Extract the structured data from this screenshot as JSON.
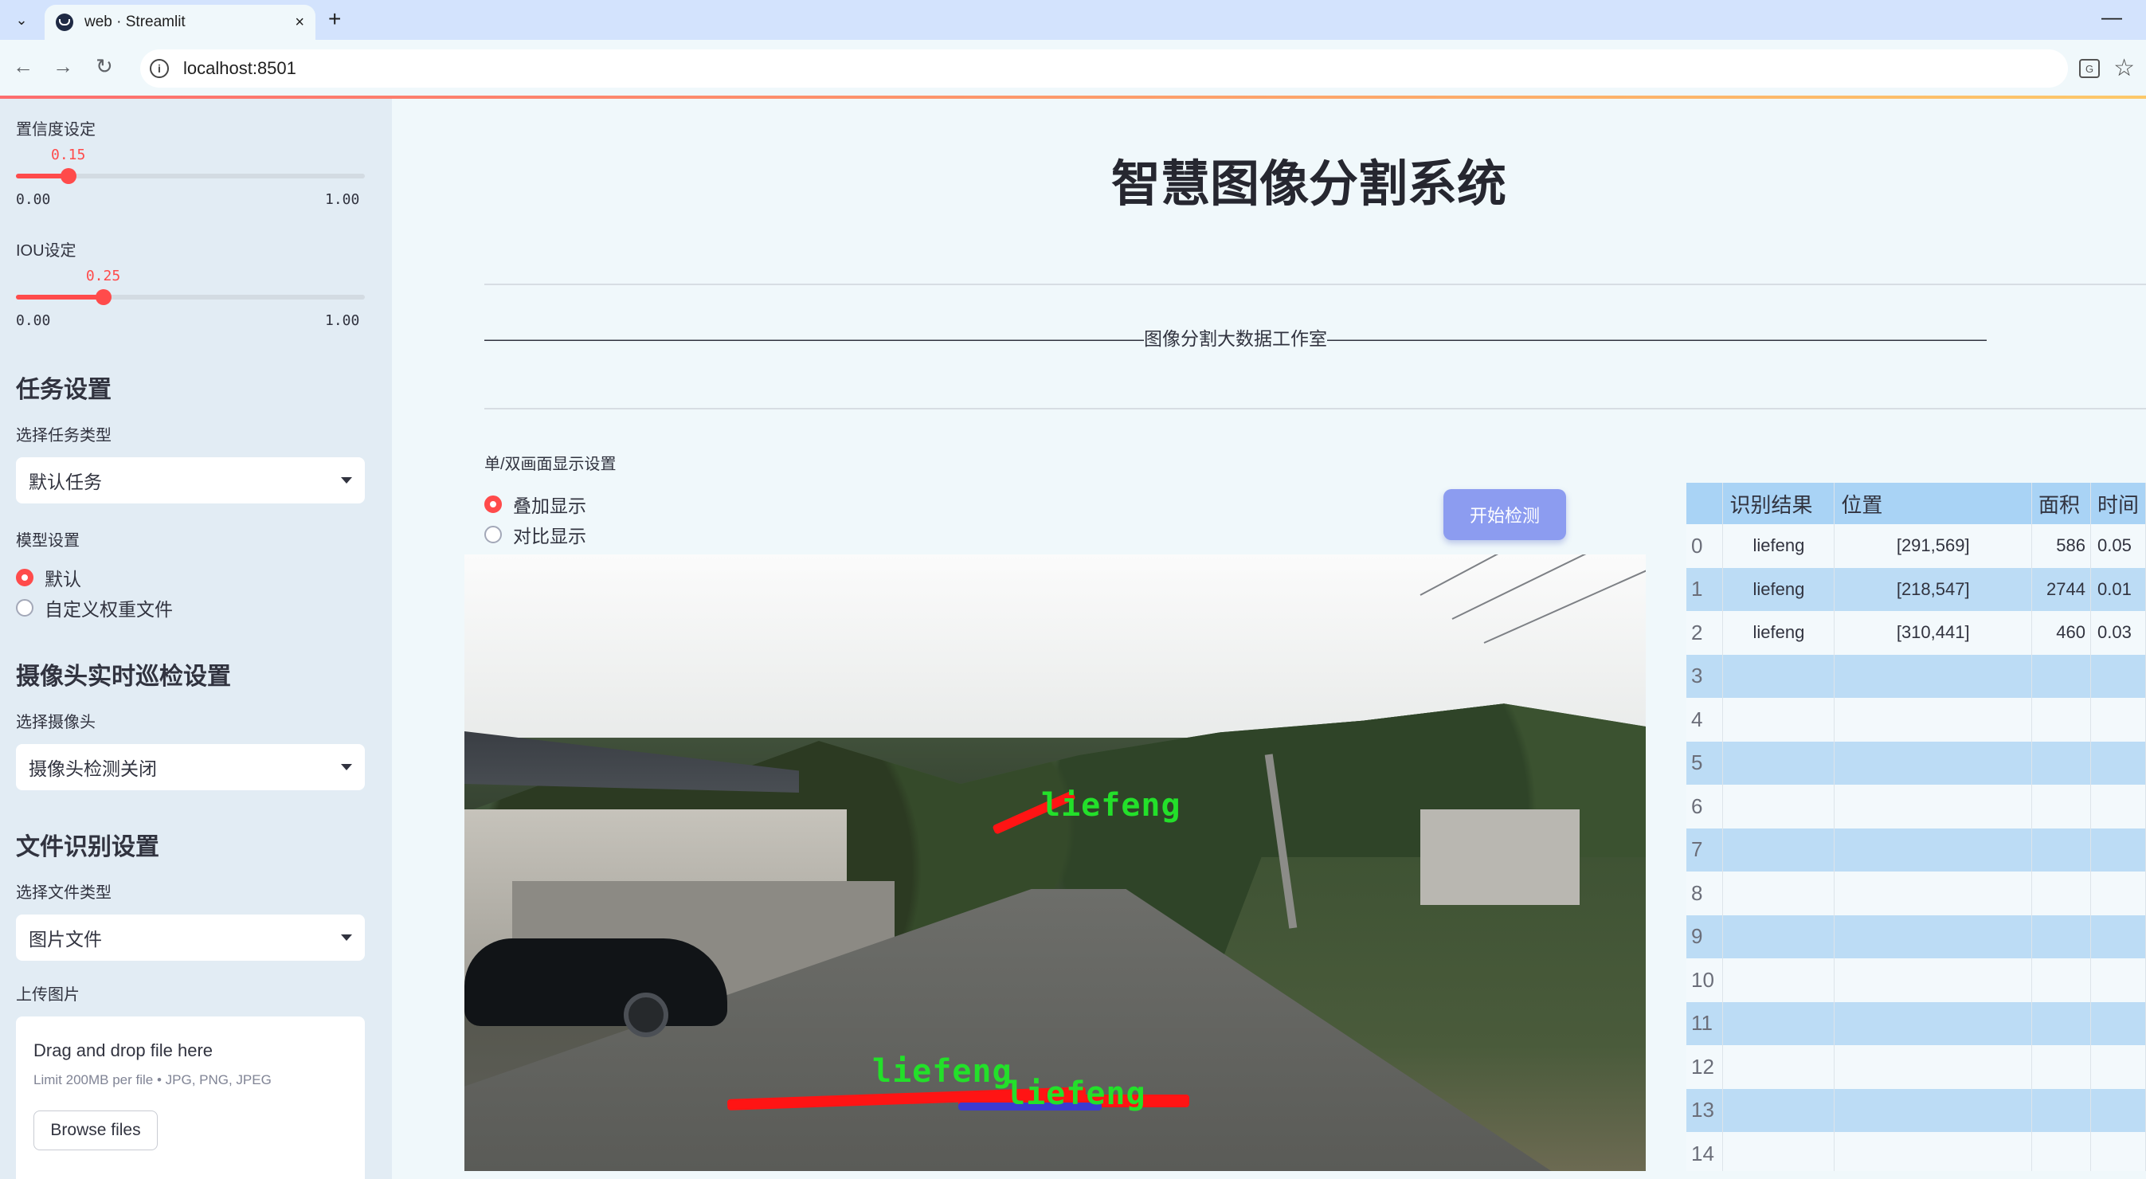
{
  "browser": {
    "tab_title": "web · Streamlit",
    "url": "localhost:8501",
    "new_tab_symbol": "+",
    "close_symbol": "×"
  },
  "sidebar": {
    "confidence": {
      "label": "置信度设定",
      "value": 0.15,
      "value_text": "0.15",
      "min": "0.00",
      "max": "1.00"
    },
    "iou": {
      "label": "IOU设定",
      "value": 0.25,
      "value_text": "0.25",
      "min": "0.00",
      "max": "1.00"
    },
    "task": {
      "heading": "任务设置",
      "label": "选择任务类型",
      "selected": "默认任务"
    },
    "model": {
      "label": "模型设置",
      "options": [
        "默认",
        "自定义权重文件"
      ],
      "selected_index": 0
    },
    "camera": {
      "heading": "摄像头实时巡检设置",
      "label": "选择摄像头",
      "selected": "摄像头检测关闭"
    },
    "file": {
      "heading": "文件识别设置",
      "label": "选择文件类型",
      "selected": "图片文件"
    },
    "upload": {
      "label": "上传图片",
      "title": "Drag and drop file here",
      "subtitle": "Limit 200MB per file • JPG, PNG, JPEG",
      "button": "Browse files"
    }
  },
  "main": {
    "title": "智慧图像分割系统",
    "banner": "————————————————————————————————————图像分割大数据工作室————————————————————————————————————",
    "view_label": "单/双画面显示设置",
    "view_options": [
      "叠加显示",
      "对比显示"
    ],
    "view_selected_index": 0,
    "start_button": "开始检测",
    "detections": [
      {
        "label": "liefeng"
      },
      {
        "label": "liefeng"
      },
      {
        "label": "liefeng"
      }
    ]
  },
  "table": {
    "columns": [
      "识别结果",
      "位置",
      "面积",
      "时间"
    ],
    "rows": [
      {
        "idx": "0",
        "result": "liefeng",
        "pos": "[291,569]",
        "area": "586",
        "time": "0.05"
      },
      {
        "idx": "1",
        "result": "liefeng",
        "pos": "[218,547]",
        "area": "2744",
        "time": "0.01"
      },
      {
        "idx": "2",
        "result": "liefeng",
        "pos": "[310,441]",
        "area": "460",
        "time": "0.03"
      },
      {
        "idx": "3",
        "result": "",
        "pos": "",
        "area": "",
        "time": ""
      },
      {
        "idx": "4",
        "result": "",
        "pos": "",
        "area": "",
        "time": ""
      },
      {
        "idx": "5",
        "result": "",
        "pos": "",
        "area": "",
        "time": ""
      },
      {
        "idx": "6",
        "result": "",
        "pos": "",
        "area": "",
        "time": ""
      },
      {
        "idx": "7",
        "result": "",
        "pos": "",
        "area": "",
        "time": ""
      },
      {
        "idx": "8",
        "result": "",
        "pos": "",
        "area": "",
        "time": ""
      },
      {
        "idx": "9",
        "result": "",
        "pos": "",
        "area": "",
        "time": ""
      },
      {
        "idx": "10",
        "result": "",
        "pos": "",
        "area": "",
        "time": ""
      },
      {
        "idx": "11",
        "result": "",
        "pos": "",
        "area": "",
        "time": ""
      },
      {
        "idx": "12",
        "result": "",
        "pos": "",
        "area": "",
        "time": ""
      },
      {
        "idx": "13",
        "result": "",
        "pos": "",
        "area": "",
        "time": ""
      },
      {
        "idx": "14",
        "result": "",
        "pos": "",
        "area": "",
        "time": ""
      }
    ]
  },
  "colors": {
    "accent": "#ff4b4b",
    "button": "#8c9cf0",
    "table_header": "#a9d3f5",
    "mask": "#ff1414",
    "label": "#23e02a"
  }
}
